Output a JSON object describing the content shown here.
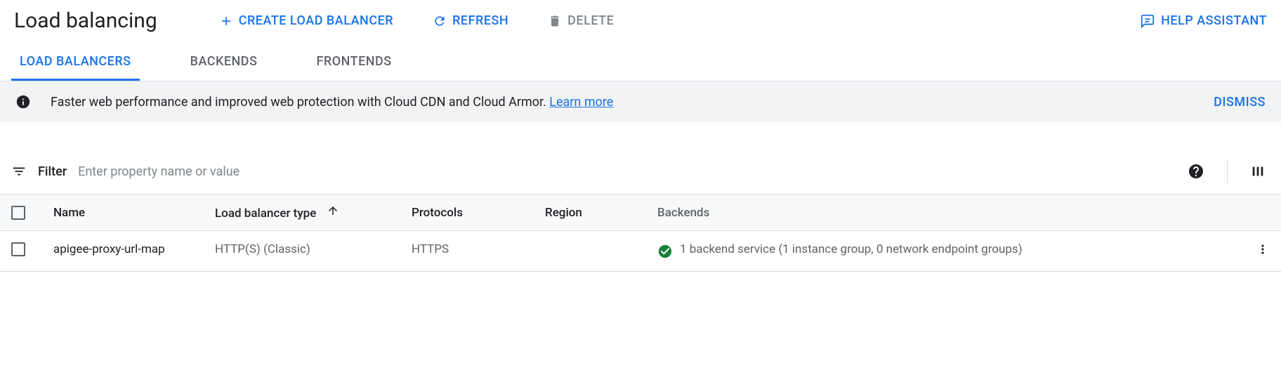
{
  "header": {
    "title": "Load balancing",
    "create_label": "CREATE LOAD BALANCER",
    "refresh_label": "REFRESH",
    "delete_label": "DELETE",
    "help_label": "HELP ASSISTANT"
  },
  "tabs": {
    "load_balancers": "LOAD BALANCERS",
    "backends": "BACKENDS",
    "frontends": "FRONTENDS"
  },
  "banner": {
    "text": "Faster web performance and improved web protection with Cloud CDN and Cloud Armor. ",
    "link": "Learn more",
    "dismiss": "DISMISS"
  },
  "filter": {
    "label": "Filter",
    "placeholder": "Enter property name or value"
  },
  "table": {
    "headers": {
      "name": "Name",
      "type": "Load balancer type",
      "protocols": "Protocols",
      "region": "Region",
      "backends": "Backends"
    },
    "rows": [
      {
        "name": "apigee-proxy-url-map",
        "type": "HTTP(S) (Classic)",
        "protocols": "HTTPS",
        "region": "",
        "backends": "1 backend service (1 instance group, 0 network endpoint groups)"
      }
    ]
  }
}
